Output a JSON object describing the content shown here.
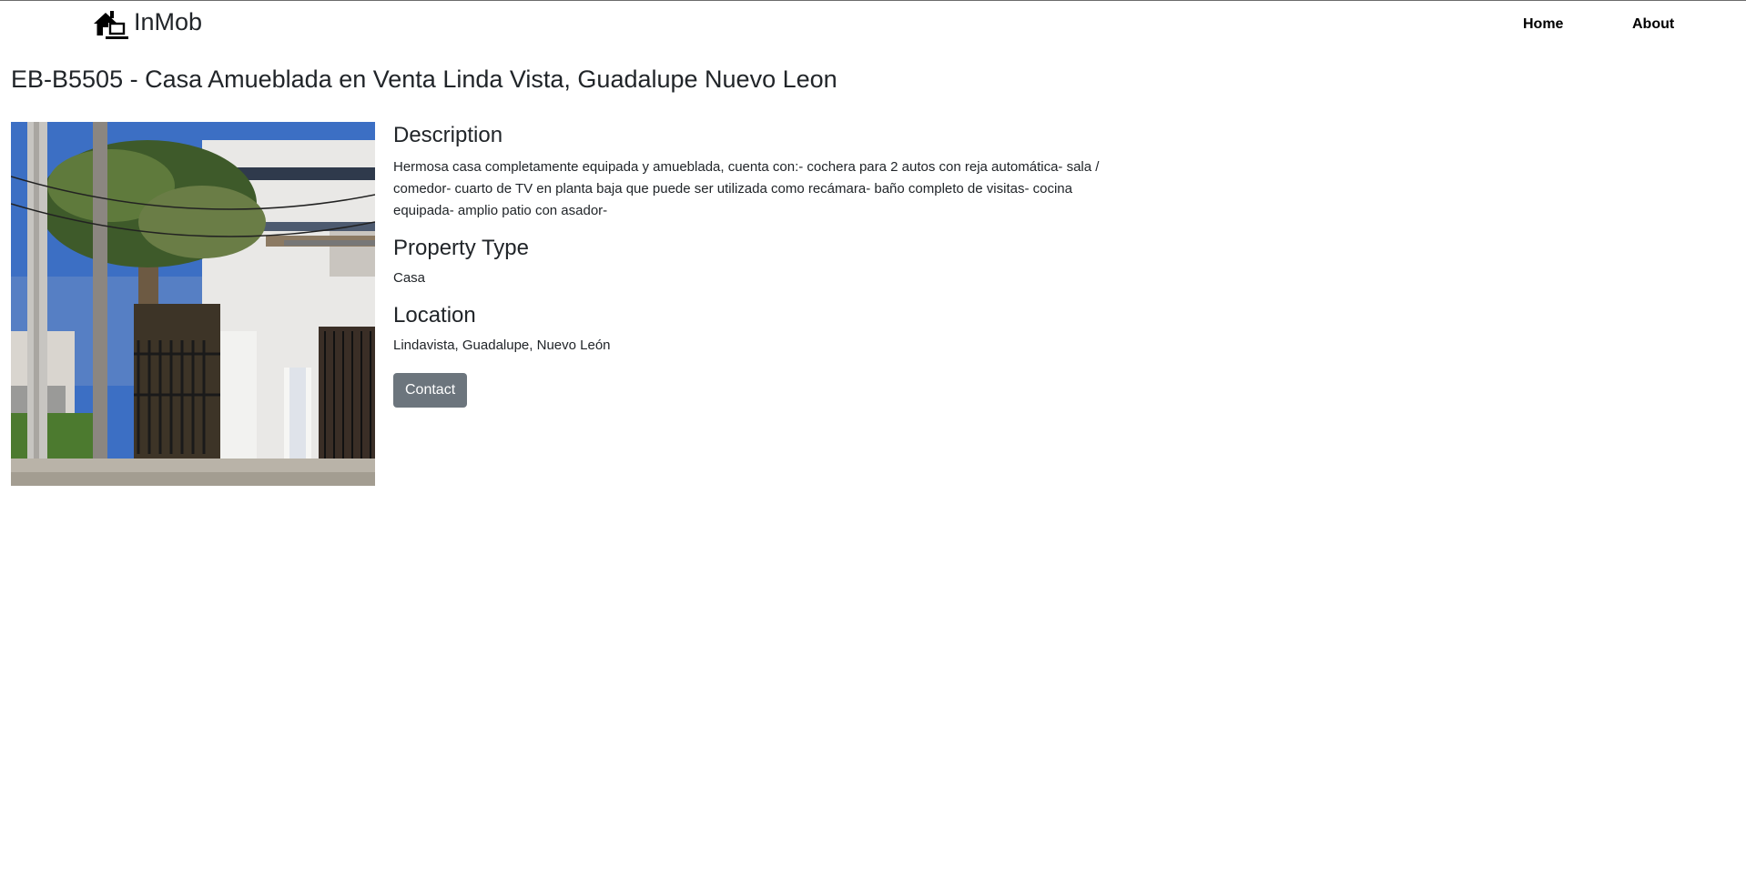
{
  "brand": {
    "name": "InMob",
    "icon": "house-laptop-icon"
  },
  "nav": {
    "home": "Home",
    "about": "About"
  },
  "listing": {
    "title": "EB-B5505 - Casa Amueblada en Venta Linda Vista, Guadalupe Nuevo Leon",
    "image_alt": "Casa Amueblada en Venta Linda Vista",
    "description_heading": "Description",
    "description": "Hermosa casa completamente equipada y amueblada, cuenta con:- cochera para 2 autos con reja automática- sala / comedor- cuarto de TV en planta baja que puede ser utilizada como recámara- baño completo de visitas- cocina equipada- amplio patio con asador-",
    "type_heading": "Property Type",
    "type": "Casa",
    "location_heading": "Location",
    "location": "Lindavista, Guadalupe, Nuevo León",
    "contact_label": "Contact"
  },
  "colors": {
    "button": "#6c757d",
    "text": "#212529",
    "background": "#ffffff"
  }
}
